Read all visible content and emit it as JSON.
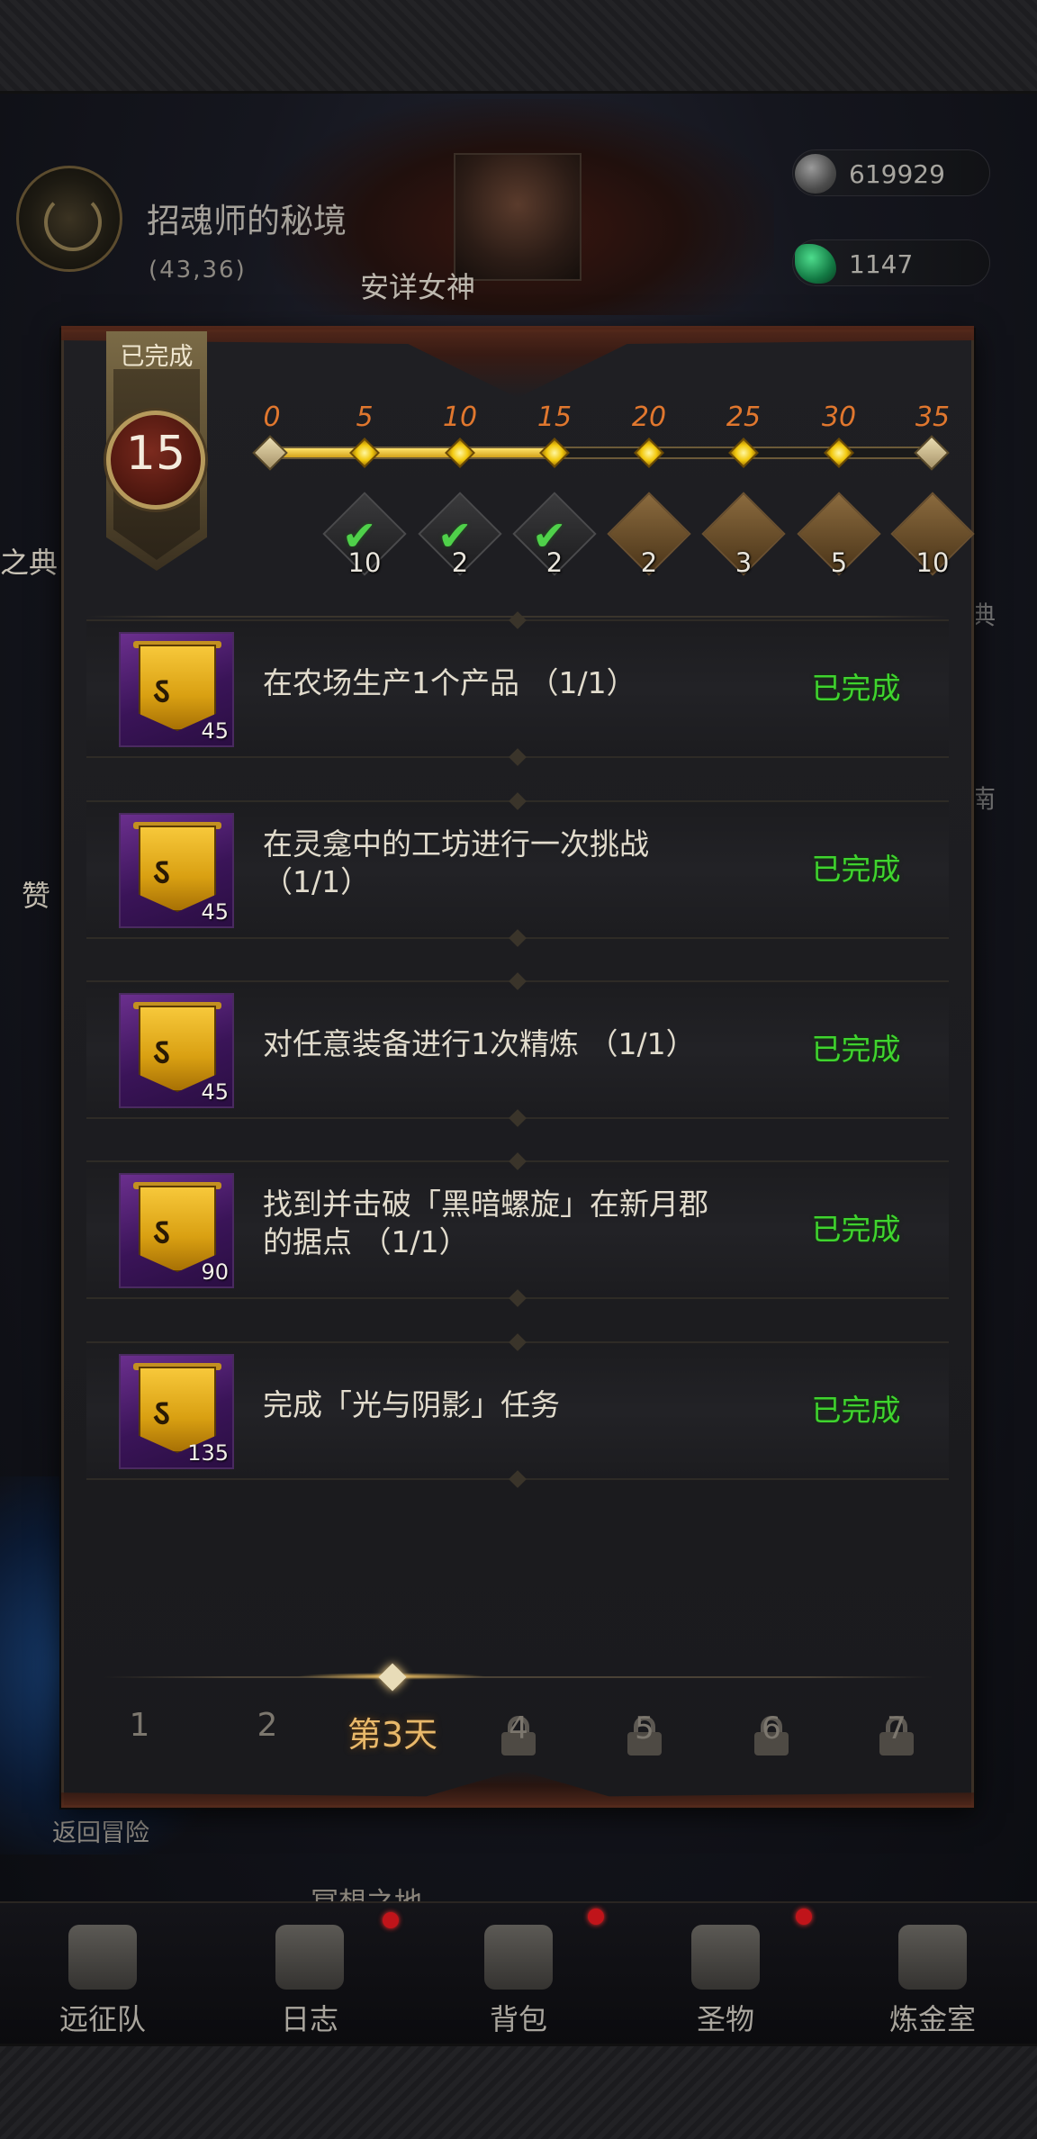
{
  "background": {
    "location_name": "招魂师的秘境",
    "location_coords": "(43,36)",
    "npc_name": "安详女神",
    "resources": [
      {
        "icon": "stone-icon",
        "value": "619929"
      },
      {
        "icon": "green-crystal-icon",
        "value": "1147"
      }
    ],
    "left_label_1": "之典",
    "left_label_2": "赞",
    "right_label_1": "典",
    "right_label_2": "南",
    "return_link": "返回冒险",
    "below_panel_text": "冥想之地"
  },
  "panel": {
    "completed_label": "已完成",
    "current_points": "15",
    "progress_ticks": [
      "0",
      "5",
      "10",
      "15",
      "20",
      "25",
      "30",
      "35"
    ],
    "progress_value": 15,
    "progress_max": 35,
    "milestone_rewards": [
      {
        "count": "10",
        "claimed": true,
        "icon": "green-check-icon"
      },
      {
        "count": "2",
        "claimed": true,
        "icon": "green-check-icon"
      },
      {
        "count": "2",
        "claimed": true,
        "icon": "green-check-icon"
      },
      {
        "count": "2",
        "claimed": false,
        "icon": "scroll-icon"
      },
      {
        "count": "3",
        "claimed": false,
        "icon": "scroll-icon"
      },
      {
        "count": "5",
        "claimed": false,
        "icon": "scroll-icon"
      },
      {
        "count": "10",
        "claimed": false,
        "icon": "scroll-icon"
      }
    ],
    "tasks": [
      {
        "text": "在农场生产1个产品 （1/1）",
        "reward_qty": "45",
        "status": "已完成"
      },
      {
        "text": "在灵龛中的工坊进行一次挑战 （1/1）",
        "reward_qty": "45",
        "status": "已完成"
      },
      {
        "text": "对任意装备进行1次精炼 （1/1）",
        "reward_qty": "45",
        "status": "已完成"
      },
      {
        "text": "找到并击破「黑暗螺旋」在新月郡的据点 （1/1）",
        "reward_qty": "90",
        "status": "已完成"
      },
      {
        "text": "完成「光与阴影」任务",
        "reward_qty": "135",
        "status": "已完成"
      }
    ],
    "day_tabs": [
      {
        "label": "1",
        "locked": false
      },
      {
        "label": "2",
        "locked": false
      },
      {
        "label": "第3天",
        "locked": false,
        "active": true
      },
      {
        "label": "4",
        "locked": true
      },
      {
        "label": "5",
        "locked": true
      },
      {
        "label": "6",
        "locked": true
      },
      {
        "label": "7",
        "locked": true
      }
    ]
  },
  "bottom_nav": [
    {
      "label": "远征队",
      "icon": "horned-helmet-icon",
      "badge": false
    },
    {
      "label": "日志",
      "icon": "journal-icon",
      "badge": true
    },
    {
      "label": "背包",
      "icon": "backpack-icon",
      "badge": true
    },
    {
      "label": "圣物",
      "icon": "relic-icon",
      "badge": true
    },
    {
      "label": "炼金室",
      "icon": "alchemy-icon",
      "badge": false
    }
  ],
  "colors": {
    "status_complete": "#3fd42e",
    "tick_label": "#e0772e",
    "active_tab": "#e8b86a"
  }
}
